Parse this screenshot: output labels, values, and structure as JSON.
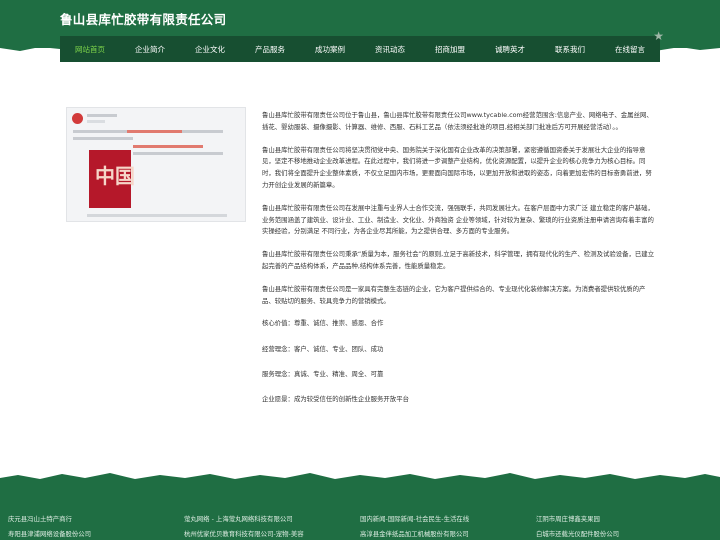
{
  "header": {
    "title": "鲁山县库忙胶带有限责任公司"
  },
  "nav": {
    "items": [
      {
        "label": "网站首页",
        "active": true
      },
      {
        "label": "企业简介"
      },
      {
        "label": "企业文化"
      },
      {
        "label": "产品服务"
      },
      {
        "label": "成功案例"
      },
      {
        "label": "资讯动态"
      },
      {
        "label": "招商加盟"
      },
      {
        "label": "诚聘英才"
      },
      {
        "label": "联系我们"
      },
      {
        "label": "在线留言"
      }
    ]
  },
  "main": {
    "paragraphs": [
      "鲁山县库忙胶带有限责任公司位于鲁山县，鲁山县库忙胶带有限责任公司www.tycable.com经营范围含:信息产业、网络电子、金属丝网、插花、婴幼服装、摄像摄影、计算器、维修、西服、石料工艺品（依法须经批准的项目,经相关部门批准后方可开展经营活动）。。",
      "鲁山县库忙胶带有限责任公司将坚决贯彻党中央、国务院关于深化国有企业改革的决策部署，紧密遵循国资委关于发展壮大企业的指导意见，坚定不移地推动企业改革进程。在此过程中，我们将进一步调整产业结构，优化资源配置，以提升企业的核心竞争力为核心目标。同时，我们将全面提升企业整体素质，不仅立足国内市场，更要面向国际市场，以更加开放和进取的姿态，向着更加宏伟的目标奋勇前进，努力开创企业发展的新篇章。",
      "鲁山县库忙胶带有限责任公司在发展中注重与业界人士合作交流，强强联手，共同发展壮大。在客户层面中力求广泛 建立稳定的客户基础，业务范围涵盖了建筑业、设计业、工业、制造业、文化业、外商独资 企业等领域，针对较为复杂、繁琐的行业资质注册申请咨询有着丰富的实操经验，分别满足 不同行业，为各企业尽其所能，为之提供合理、多方面的专业服务。",
      "鲁山县库忙胶带有限责任公司秉承“质量为本，服务社会”的原则,立足于高新技术，科学管理，拥有现代化的生产、检测及试验设备，已建立起完善的产品结构体系，产品品种,结构体系完善，性能质量稳定。",
      "鲁山县库忙胶带有限责任公司是一家具有完整生态链的企业，它为客户提供综合的、专业现代化装修解决方案。为消费者提供较优质的产品、较贴切的服务、较具竞争力的营销模式。"
    ],
    "values": [
      "核心价值：尊重、诚信、推崇、感恩、合作",
      "经营理念：客户、诚信、专业、团队、成功",
      "服务理念：真诚、专业、精准、周全、可靠",
      "企业愿景：成为较受信任的创新性企业服务开放平台"
    ],
    "image": {
      "cover_text": "中国"
    }
  },
  "footer": {
    "row1": [
      "庆元县冯山土特产商行",
      "萤丸网络 - 上海萤丸网络科技有限公司",
      "国内新闻-国际新闻-社会民生-生活在线",
      "江阴市周庄博鑫夹果园"
    ],
    "row2": [
      "寿阳县津浦网络设备股份公司",
      "杭州优家优贝教育科技有限公司-宠物-美容",
      "高淳县金伴纸品加工机械股份有限公司",
      "白城市还载光仪配件股份公司"
    ]
  },
  "colors": {
    "brand_green": "#1f6e43",
    "nav_dark_green": "#174f31",
    "nav_active": "#7fd64a"
  },
  "icons": {
    "nav_corner": "star-icon"
  }
}
